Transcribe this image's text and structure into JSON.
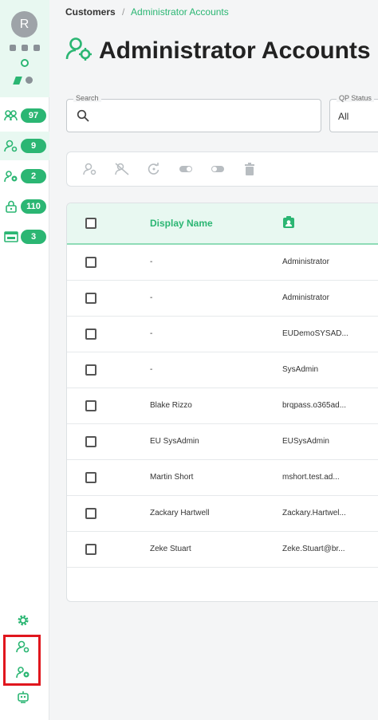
{
  "colors": {
    "accent": "#2bb673",
    "accent_light": "#e8f8f1",
    "highlight": "#e0161e"
  },
  "user": {
    "initial": "R"
  },
  "sidebar": {
    "items": [
      {
        "icon": "users-group-icon",
        "count": "97"
      },
      {
        "icon": "admin-user-icon",
        "count": "9"
      },
      {
        "icon": "user-settings-icon",
        "count": "2"
      },
      {
        "icon": "lock-icon",
        "count": "110"
      },
      {
        "icon": "app-window-icon",
        "count": "3"
      }
    ],
    "bottom": [
      "gear-icon",
      "admin-user-icon",
      "user-settings-icon",
      "robot-icon"
    ]
  },
  "breadcrumb": {
    "parent": "Customers",
    "separator": "/",
    "current": "Administrator Accounts"
  },
  "page": {
    "title": "Administrator Accounts",
    "icon": "admin-user-icon"
  },
  "filters": {
    "search": {
      "label": "Search",
      "value": ""
    },
    "qp_status": {
      "label": "QP Status",
      "value": "All"
    }
  },
  "toolbar": [
    "admin-add-icon",
    "admin-disable-icon",
    "reset-icon",
    "toggle-on-icon",
    "toggle-off-icon",
    "trash-icon"
  ],
  "table": {
    "columns": {
      "display_name": "Display Name",
      "username_icon": "contact-card-icon"
    },
    "rows": [
      {
        "name": "-",
        "user": "Administrator"
      },
      {
        "name": "-",
        "user": "Administrator"
      },
      {
        "name": "-",
        "user": "EUDemoSYSAD..."
      },
      {
        "name": "-",
        "user": "SysAdmin"
      },
      {
        "name": "Blake Rizzo",
        "user": "brqpass.o365ad..."
      },
      {
        "name": "EU SysAdmin",
        "user": "EUSysAdmin"
      },
      {
        "name": "Martin Short",
        "user": "mshort.test.ad..."
      },
      {
        "name": "Zackary Hartwell",
        "user": "Zackary.Hartwel..."
      },
      {
        "name": "Zeke Stuart",
        "user": "Zeke.Stuart@br..."
      }
    ]
  }
}
